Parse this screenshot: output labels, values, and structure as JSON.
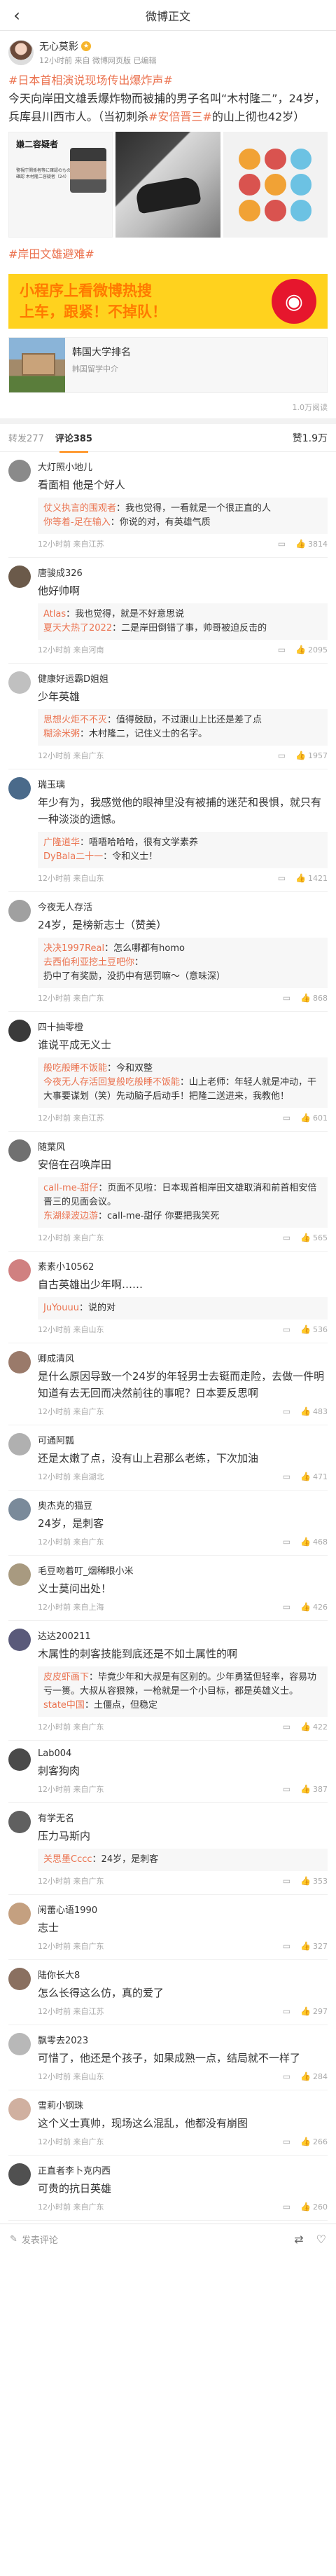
{
  "nav": {
    "back": "‹",
    "title": "微博正文"
  },
  "post": {
    "author": "无心莫影",
    "meta": "12小时前 来自 微博网页版 已编辑",
    "text_tag1": "#日本首相演说现场传出爆炸声#",
    "text_body": "今天向岸田文雄丢爆炸物而被捕的男子名叫“木村隆二”，24岁，兵库县川西市人。（当初刺杀",
    "text_tag2": "#安倍晋三#",
    "text_tail": "的山上彻也42岁）",
    "img1_title": "嫌二容疑者",
    "img1_sub": "警視庁関係者等に確認のもの本名確認 木村隆二容疑者（24）",
    "hashtag2": "#岸田文雄避难#"
  },
  "banner": {
    "line1": "小程序上看微博热搜",
    "line2": "上车，跟紧！不掉队！"
  },
  "card": {
    "title": "韩国大学排名",
    "desc": "韩国留学中介"
  },
  "read_count": "1.0万阅读",
  "tabs": {
    "reposts": "转发277",
    "comments": "评论385",
    "likes": "赞1.9万"
  },
  "comments": [
    {
      "user": "大灯照小地儿",
      "text": "看面相 他是个好人",
      "replies": [
        {
          "u": "仗义执言的围观者",
          "t": "我也觉得，一看就是一个很正直的人"
        },
        {
          "u": "你等着-足在输入",
          "t": "你说的对，有英雄气质"
        }
      ],
      "time": "12小时前 来自江苏",
      "likes": "3814",
      "avatar_color": "#8a8a8a"
    },
    {
      "user": "唐骏成326",
      "text": "他好帅啊",
      "replies": [
        {
          "u": "Atlas",
          "t": "我也觉得，就是不好意思说"
        },
        {
          "u": "夏天大热了2022",
          "t": "二是岸田倒错了事，帅哥被迫反击的"
        }
      ],
      "time": "12小时前 来自河南",
      "likes": "2095",
      "avatar_color": "#6b5a4a"
    },
    {
      "user": "健康好运霸D姐姐",
      "text": "少年英雄",
      "replies": [
        {
          "u": "思想火炬不不灭",
          "t": "值得鼓励，不过跟山上比还是差了点"
        },
        {
          "u": "糊涂米粥",
          "t": "木村隆二，记住义士的名字。"
        }
      ],
      "time": "12小时前 来自广东",
      "likes": "1957",
      "avatar_color": "#c0c0c0"
    },
    {
      "user": "瑞玉璃",
      "text": "年少有为，我感觉他的眼神里没有被捕的迷茫和畏惧，就只有一种淡淡的遗憾。",
      "replies": [
        {
          "u": "广隆道华",
          "t": "唔唔哈哈哈，很有文学素养"
        },
        {
          "u": "DyBala二十一",
          "t": "令和义士！"
        }
      ],
      "time": "12小时前 来自山东",
      "likes": "1421",
      "avatar_color": "#4a6a8a"
    },
    {
      "user": "今夜无人存活",
      "text": "24岁，是榜新志士（赞美）",
      "replies": [
        {
          "u": "决决1997Real",
          "t": "怎么哪都有homo"
        },
        {
          "u": "去西伯利亚挖土豆吧你",
          "t": "扔中了有奖励，没扔中有惩罚嘛～（意味深）"
        }
      ],
      "time": "12小时前 来自广东",
      "likes": "868",
      "avatar_color": "#a0a0a0"
    },
    {
      "user": "四十抽零橙",
      "text": "谁说平成无义士",
      "replies": [
        {
          "u": "般吃般睡不饭能",
          "t": "今和双整"
        },
        {
          "u": "今夜无人存活回复般吃般睡不饭能",
          "t": "山上老师：年轻人就是冲动，干大事要谋划（笑）先动脑子后动手！把隆二送进来，我教他！"
        }
      ],
      "time": "12小时前 来自江苏",
      "likes": "601",
      "avatar_color": "#3a3a3a"
    },
    {
      "user": "随葉风",
      "text": "安倍在召唤岸田",
      "replies": [
        {
          "u": "call-me-甜仔",
          "t": "页面不见啦：日本现首相岸田文雄取消和前首相安倍晋三的见面会议。"
        },
        {
          "u": "东湖绿波边游",
          "t": "call-me-甜仔 你要把我笑死"
        }
      ],
      "time": "12小时前 来自广东",
      "likes": "565",
      "avatar_color": "#707070"
    },
    {
      "user": "素素小10562",
      "text": "自古英雄出少年啊……",
      "replies": [
        {
          "u": "JuYouuu",
          "t": "说的对"
        }
      ],
      "time": "12小时前 来自山东",
      "likes": "536",
      "avatar_color": "#d08080"
    },
    {
      "user": "卿成清风",
      "text": "是什么原因导致一个24岁的年轻男士去铤而走险，去做一件明知道有去无回而决然前往的事呢？日本要反思啊",
      "replies": [],
      "time": "12小时前 来自广东",
      "likes": "483",
      "avatar_color": "#9a7a6a"
    },
    {
      "user": "可通阿瓢",
      "text": "还是太嫩了点，没有山上君那么老练，下次加油",
      "replies": [],
      "time": "12小时前 来自湖北",
      "likes": "471",
      "avatar_color": "#b0b0b0"
    },
    {
      "user": "奥杰克的猫豆",
      "text": "24岁，是刺客",
      "replies": [],
      "time": "12小时前 来自广东",
      "likes": "468",
      "avatar_color": "#7a8a9a"
    },
    {
      "user": "毛豆吻着叮_烟稀眼小米",
      "text": "义士莫问出处！",
      "replies": [],
      "time": "12小时前 来自上海",
      "likes": "426",
      "avatar_color": "#a89a80"
    },
    {
      "user": "达达200211",
      "text": "木属性的刺客技能到底还是不如土属性的啊",
      "replies": [
        {
          "u": "皮皮虾画下",
          "t": "毕竟少年和大叔是有区别的。少年勇猛但轻率，容易功亏一篑。大叔从容狠辣，一枪就是一个小目标，都是英雄义士。"
        },
        {
          "u": "state中国",
          "t": "土僵点，但稳定"
        }
      ],
      "time": "12小时前 来自广东",
      "likes": "422",
      "avatar_color": "#5a5a7a"
    },
    {
      "user": "Lab004",
      "text": "刺客狗肉",
      "replies": [],
      "time": "12小时前 来自广东",
      "likes": "387",
      "avatar_color": "#4a4a4a"
    },
    {
      "user": "有学无名",
      "text": "压力马斯内",
      "replies": [
        {
          "u": "关思墨Cccc",
          "t": "24岁，是刺客"
        }
      ],
      "time": "12小时前 来自广东",
      "likes": "353",
      "avatar_color": "#606060"
    },
    {
      "user": "闲蕾心语1990",
      "text": "志士",
      "replies": [],
      "time": "12小时前 来自广东",
      "likes": "327",
      "avatar_color": "#c4a080"
    },
    {
      "user": "陆你长大8",
      "text": "怎么长得这么仿，真的爱了",
      "replies": [],
      "time": "12小时前 来自江苏",
      "likes": "297",
      "avatar_color": "#8a7060"
    },
    {
      "user": "飘零去2023",
      "text": "可惜了，他还是个孩子，如果成熟一点，结局就不一样了",
      "replies": [],
      "time": "12小时前 来自山东",
      "likes": "284",
      "avatar_color": "#b8b8b8"
    },
    {
      "user": "雪莉小钢珠",
      "text": "这个义士真帅，现场这么混乱，他都没有崩图",
      "replies": [],
      "time": "12小时前 来自广东",
      "likes": "266",
      "avatar_color": "#d0b0a0"
    },
    {
      "user": "正直者李卜克内西",
      "text": "可贵的抗日英雄",
      "replies": [],
      "time": "12小时前 来自广东",
      "likes": "260",
      "avatar_color": "#505050"
    }
  ],
  "bottom": {
    "placeholder": "发表评论"
  }
}
